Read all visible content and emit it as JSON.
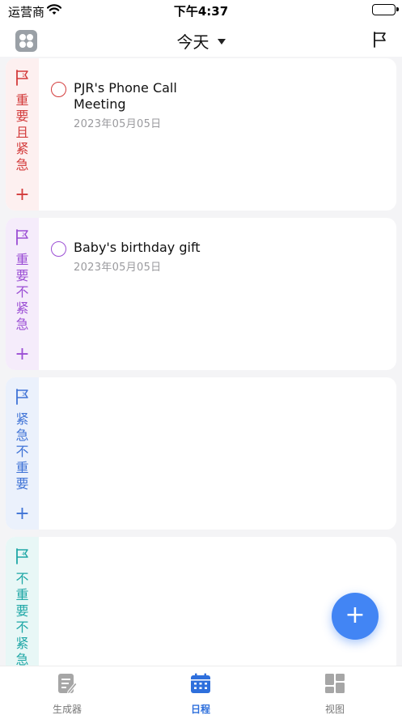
{
  "status_bar": {
    "carrier": "运营商",
    "time": "下午4:37"
  },
  "nav": {
    "title": "今天"
  },
  "quadrants": [
    {
      "label": "重要且紧急",
      "color": "#d33b3b",
      "add_label": "+",
      "tasks": [
        {
          "title": "PJR's Phone Call Meeting",
          "date": "2023年05月05日"
        }
      ]
    },
    {
      "label": "重要不紧急",
      "color": "#9b4ed4",
      "add_label": "+",
      "tasks": [
        {
          "title": "Baby's birthday gift",
          "date": "2023年05月05日"
        }
      ]
    },
    {
      "label": "紧急不重要",
      "color": "#3f73d6",
      "add_label": "+",
      "tasks": []
    },
    {
      "label": "不重要不紧急",
      "color": "#1fa7a6",
      "add_label": "+",
      "tasks": []
    }
  ],
  "fab": {
    "label": "+"
  },
  "tabbar": {
    "tabs": [
      {
        "label": "生成器",
        "icon": "note-edit-icon",
        "active": false
      },
      {
        "label": "日程",
        "icon": "calendar-icon",
        "active": true
      },
      {
        "label": "视图",
        "icon": "grid-view-icon",
        "active": false
      }
    ],
    "active_color": "#2e6fdc",
    "inactive_color": "#a6a6a6"
  }
}
